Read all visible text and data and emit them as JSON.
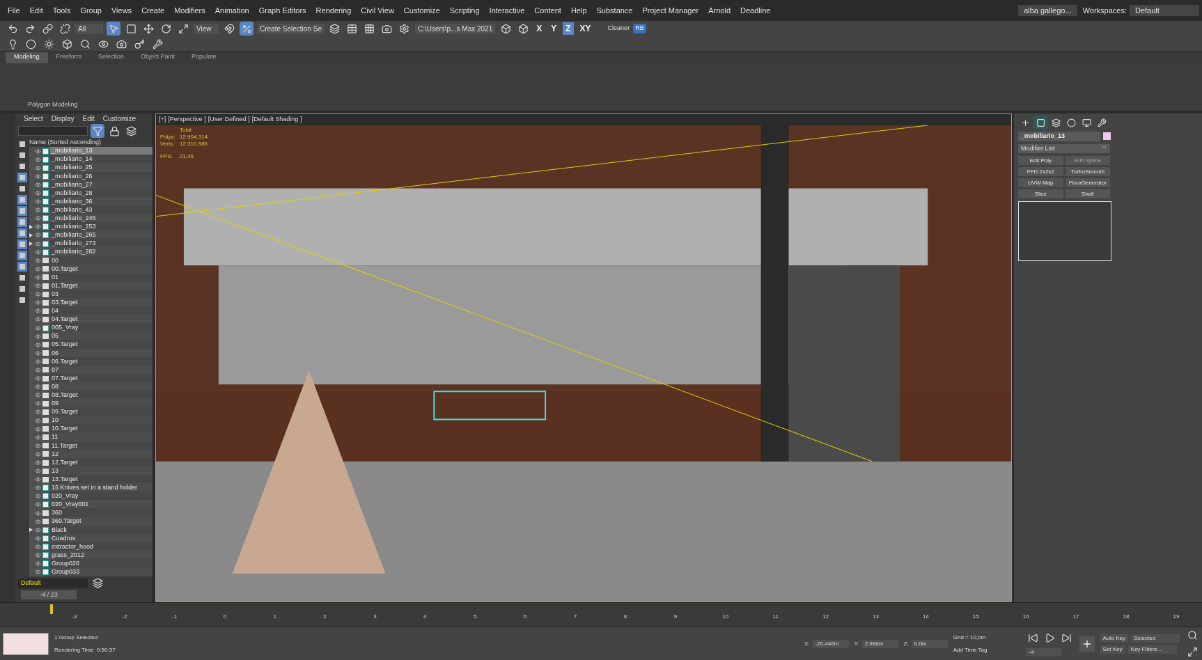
{
  "menu_bar": {
    "items": [
      "File",
      "Edit",
      "Tools",
      "Group",
      "Views",
      "Create",
      "Modifiers",
      "Animation",
      "Graph Editors",
      "Rendering",
      "Civil View",
      "Customize",
      "Scripting",
      "Interactive",
      "Content",
      "Help",
      "Substance",
      "Project Manager",
      "Arnold",
      "Deadline"
    ],
    "user": "alba gallego...",
    "workspaces_label": "Workspaces:",
    "workspace": "Default"
  },
  "toolbar": {
    "selection_filter": "All",
    "reference_coord": "View",
    "named_selection": "Create Selection Se",
    "project_path": "C:\\Users\\p...s Max 2021",
    "axis_buttons": [
      {
        "label": "X",
        "selected": false
      },
      {
        "label": "Y",
        "selected": false
      },
      {
        "label": "Z",
        "selected": true
      },
      {
        "label": "XY",
        "selected": false
      }
    ],
    "cleaner": "Cleaner",
    "rb": "RB"
  },
  "ribbon": {
    "tabs": [
      {
        "label": "Modeling",
        "selected": true
      },
      {
        "label": "Freeform",
        "selected": false
      },
      {
        "label": "Selection",
        "selected": false
      },
      {
        "label": "Object Paint",
        "selected": false
      },
      {
        "label": "Populate",
        "selected": false
      }
    ],
    "panel_label": "Polygon Modeling"
  },
  "scene_explorer": {
    "menu": [
      "Select",
      "Display",
      "Edit",
      "Customize"
    ],
    "filters": [
      {
        "on": false
      },
      {
        "on": false
      },
      {
        "on": false
      },
      {
        "on": true
      },
      {
        "on": false
      },
      {
        "on": true
      },
      {
        "on": true
      },
      {
        "on": true
      },
      {
        "on": true
      },
      {
        "on": true
      },
      {
        "on": true
      },
      {
        "on": true
      },
      {
        "on": false
      },
      {
        "on": false
      },
      {
        "on": false
      }
    ],
    "column_header": "Name (Sorted Ascending)",
    "rows": [
      {
        "name": "_mobiliario_13",
        "kind": "group",
        "expandable": false,
        "selected": true
      },
      {
        "name": "_mobiliario_14",
        "kind": "group",
        "expandable": false,
        "selected": false
      },
      {
        "name": "_mobiliario_25",
        "kind": "group",
        "expandable": false,
        "selected": false
      },
      {
        "name": "_mobiliario_26",
        "kind": "group",
        "expandable": false,
        "selected": false
      },
      {
        "name": "_mobiliario_27",
        "kind": "group",
        "expandable": false,
        "selected": false
      },
      {
        "name": "_mobiliario_28",
        "kind": "group",
        "expandable": false,
        "selected": false
      },
      {
        "name": "_mobiliario_36",
        "kind": "group",
        "expandable": false,
        "selected": false
      },
      {
        "name": "_mobiliario_43",
        "kind": "group",
        "expandable": false,
        "selected": false
      },
      {
        "name": "_mobiliario_246",
        "kind": "group",
        "expandable": false,
        "selected": false
      },
      {
        "name": "_mobiliario_253",
        "kind": "group",
        "expandable": true,
        "selected": false
      },
      {
        "name": "_mobiliario_265",
        "kind": "group",
        "expandable": true,
        "selected": false
      },
      {
        "name": "_mobiliario_273",
        "kind": "group",
        "expandable": true,
        "selected": false
      },
      {
        "name": "_mobiliario_282",
        "kind": "group",
        "expandable": false,
        "selected": false
      },
      {
        "name": "00",
        "kind": "camera",
        "expandable": false,
        "selected": false
      },
      {
        "name": "00.Target",
        "kind": "camera",
        "expandable": false,
        "selected": false
      },
      {
        "name": "01",
        "kind": "camera",
        "expandable": false,
        "selected": false
      },
      {
        "name": "01.Target",
        "kind": "camera",
        "expandable": false,
        "selected": false
      },
      {
        "name": "03",
        "kind": "camera",
        "expandable": false,
        "selected": false
      },
      {
        "name": "03.Target",
        "kind": "camera",
        "expandable": false,
        "selected": false
      },
      {
        "name": "04",
        "kind": "camera",
        "expandable": false,
        "selected": false
      },
      {
        "name": "04.Target",
        "kind": "camera",
        "expandable": false,
        "selected": false
      },
      {
        "name": "005_Vray",
        "kind": "group",
        "expandable": false,
        "selected": false
      },
      {
        "name": "05",
        "kind": "camera",
        "expandable": false,
        "selected": false
      },
      {
        "name": "05.Target",
        "kind": "camera",
        "expandable": false,
        "selected": false
      },
      {
        "name": "06",
        "kind": "camera",
        "expandable": false,
        "selected": false
      },
      {
        "name": "06.Target",
        "kind": "camera",
        "expandable": false,
        "selected": false
      },
      {
        "name": "07",
        "kind": "camera",
        "expandable": false,
        "selected": false
      },
      {
        "name": "07.Target",
        "kind": "camera",
        "expandable": false,
        "selected": false
      },
      {
        "name": "08",
        "kind": "camera",
        "expandable": false,
        "selected": false
      },
      {
        "name": "08.Target",
        "kind": "camera",
        "expandable": false,
        "selected": false
      },
      {
        "name": "09",
        "kind": "camera",
        "expandable": false,
        "selected": false
      },
      {
        "name": "09.Target",
        "kind": "camera",
        "expandable": false,
        "selected": false
      },
      {
        "name": "10",
        "kind": "camera",
        "expandable": false,
        "selected": false
      },
      {
        "name": "10.Target",
        "kind": "camera",
        "expandable": false,
        "selected": false
      },
      {
        "name": "11",
        "kind": "camera",
        "expandable": false,
        "selected": false
      },
      {
        "name": "11.Target",
        "kind": "camera",
        "expandable": false,
        "selected": false
      },
      {
        "name": "12",
        "kind": "camera",
        "expandable": false,
        "selected": false
      },
      {
        "name": "12.Target",
        "kind": "camera",
        "expandable": false,
        "selected": false
      },
      {
        "name": "13",
        "kind": "camera",
        "expandable": false,
        "selected": false
      },
      {
        "name": "13.Target",
        "kind": "camera",
        "expandable": false,
        "selected": false
      },
      {
        "name": "15 Knives set in a stand holder",
        "kind": "group",
        "expandable": false,
        "selected": false
      },
      {
        "name": "020_Vray",
        "kind": "group",
        "expandable": false,
        "selected": false
      },
      {
        "name": "020_Vray001",
        "kind": "group",
        "expandable": false,
        "selected": false
      },
      {
        "name": "360",
        "kind": "camera",
        "expandable": false,
        "selected": false
      },
      {
        "name": "360.Target",
        "kind": "camera",
        "expandable": false,
        "selected": false
      },
      {
        "name": "Black",
        "kind": "group",
        "expandable": true,
        "selected": false
      },
      {
        "name": "Cuadros",
        "kind": "group",
        "expandable": false,
        "selected": false
      },
      {
        "name": "extractor_hood",
        "kind": "group",
        "expandable": false,
        "selected": false
      },
      {
        "name": "grass_2012",
        "kind": "group",
        "expandable": false,
        "selected": false
      },
      {
        "name": "Group028",
        "kind": "group",
        "expandable": false,
        "selected": false
      },
      {
        "name": "Group033",
        "kind": "group",
        "expandable": false,
        "selected": false
      }
    ],
    "layer": "Default",
    "frame_counter": "-4 / 23"
  },
  "viewport": {
    "labels": [
      "[+]",
      "[Perspective ]",
      "[User Defined ]",
      "[Default Shading ]"
    ],
    "stats_header": "Total",
    "stats": [
      {
        "label": "Polys:",
        "value": "12.904.314"
      },
      {
        "label": "Verts:",
        "value": "12.310.985"
      }
    ],
    "fps_label": "FPS:",
    "fps": "21,45"
  },
  "command_panel": {
    "tabs": [
      {
        "selected": false
      },
      {
        "selected": true
      },
      {
        "selected": false
      },
      {
        "selected": false
      },
      {
        "selected": false
      },
      {
        "selected": false
      }
    ],
    "object_name": "_mobiliario_13",
    "modifier_list": "Modifier List",
    "modifiers": [
      {
        "label": "Edit Poly",
        "disabled": false
      },
      {
        "label": "Edit Spline",
        "disabled": true
      },
      {
        "label": "FFD 2x2x2",
        "disabled": false
      },
      {
        "label": "TurboSmooth",
        "disabled": false
      },
      {
        "label": "UVW Map",
        "disabled": false
      },
      {
        "label": "FloorGenerator",
        "disabled": false
      },
      {
        "label": "Slice",
        "disabled": false
      },
      {
        "label": "Shell",
        "disabled": false
      }
    ]
  },
  "timeline": {
    "ticks": [
      "-3",
      "-2",
      "-1",
      "0",
      "1",
      "2",
      "3",
      "4",
      "5",
      "6",
      "7",
      "8",
      "9",
      "10",
      "11",
      "12",
      "13",
      "14",
      "15",
      "16",
      "17",
      "18",
      "19"
    ],
    "level": 0.02
  },
  "status_bar": {
    "selection": "1 Group Selected",
    "render_time": "Rendering Time  0:50:37",
    "coords": [
      {
        "label": "X:",
        "value": "-20,446m"
      },
      {
        "label": "Y:",
        "value": "2,988m"
      },
      {
        "label": "Z:",
        "value": "0,0m"
      }
    ],
    "grid": "Grid = 10,0m",
    "add_time_tag": "Add Time Tag",
    "auto_key": "Auto Key",
    "key_mode": "Selected",
    "set_key": "Set Key",
    "key_filters": "Key Filters...",
    "current_frame": "-4"
  }
}
